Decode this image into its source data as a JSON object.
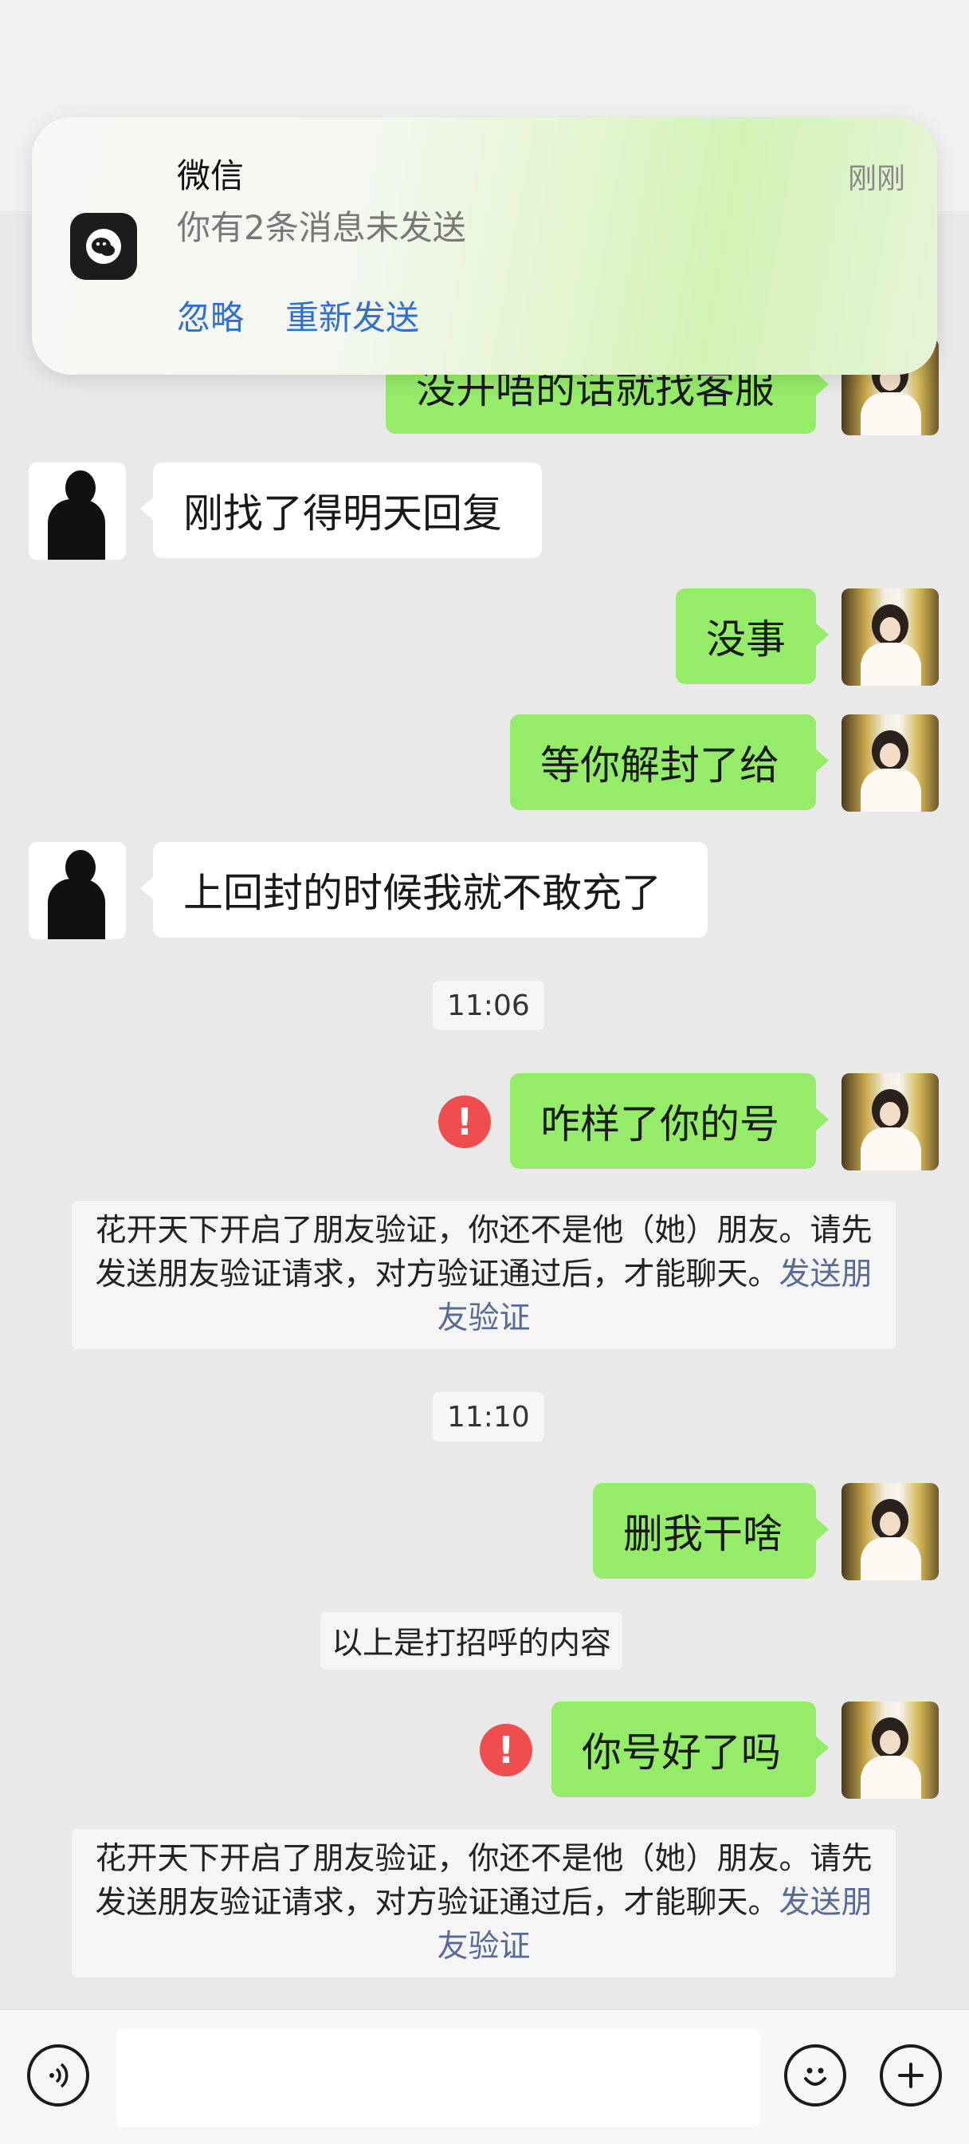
{
  "notification": {
    "app_name": "微信",
    "time": "刚刚",
    "text": "你有2条消息未发送",
    "ignore_label": "忽略",
    "resend_label": "重新发送",
    "icon": "wechat-icon"
  },
  "messages": {
    "m0": "没开唔的话就找客服",
    "m1": "刚找了得明天回复",
    "m2": "没事",
    "m3": "等你解封了给",
    "m4": "上回封的时候我就不敢充了",
    "t1": "11:06",
    "m5": "咋样了你的号",
    "sys1_text": "花开天下开启了朋友验证，你还不是他（她）朋友。请先发送朋友验证请求，对方验证通过后，才能聊天。",
    "sys1_link": "发送朋友验证",
    "t2": "11:10",
    "m6": "删我干啥",
    "hint": "以上是打招呼的内容",
    "m7": "你号好了吗",
    "sys2_text": "花开天下开启了朋友验证，你还不是他（她）朋友。请先发送朋友验证请求，对方验证通过后，才能聊天。",
    "sys2_link": "发送朋友验证",
    "error_mark": "!"
  },
  "input_bar": {
    "voice_icon": "voice-icon",
    "emoji_icon": "emoji-icon",
    "plus_icon": "plus-icon"
  }
}
